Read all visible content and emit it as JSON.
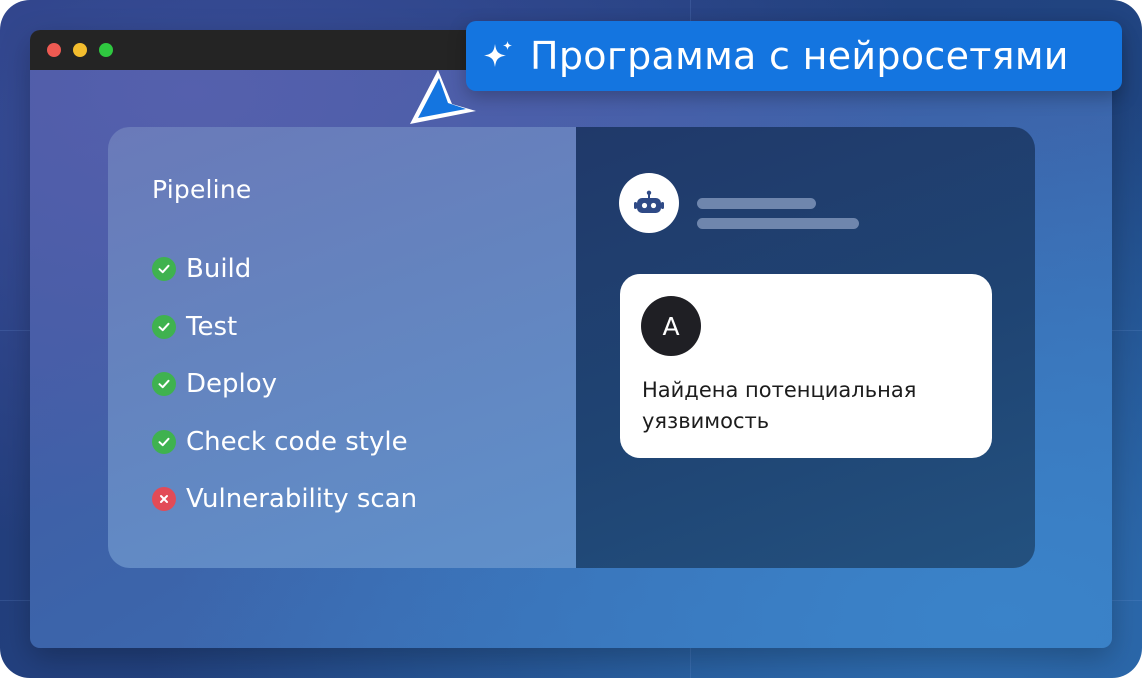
{
  "badge": {
    "text": "Программа с нейросетями",
    "icon": "sparkle-icon",
    "color": "#1475e0"
  },
  "window": {
    "traffic_lights": [
      "close",
      "minimize",
      "zoom"
    ]
  },
  "pipeline": {
    "title": "Pipeline",
    "steps": [
      {
        "label": "Build",
        "status": "success",
        "icon": "check-circle-icon"
      },
      {
        "label": "Test",
        "status": "success",
        "icon": "check-circle-icon"
      },
      {
        "label": "Deploy",
        "status": "success",
        "icon": "check-circle-icon"
      },
      {
        "label": "Check code style",
        "status": "success",
        "icon": "check-circle-icon"
      },
      {
        "label": "Vulnerability scan",
        "status": "failed",
        "icon": "x-circle-icon"
      }
    ]
  },
  "assistant": {
    "avatar_icon": "robot-icon"
  },
  "message": {
    "avatar_letter": "A",
    "text": "Найдена потенциальная уязвимость"
  },
  "colors": {
    "success": "#3fb24f",
    "failure": "#e24b57",
    "accent": "#1475e0"
  }
}
